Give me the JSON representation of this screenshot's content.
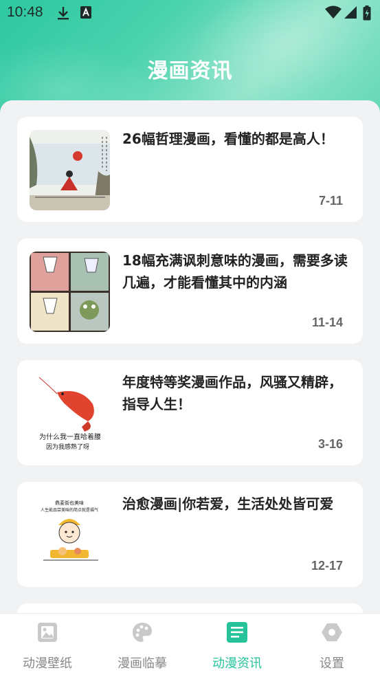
{
  "status_bar": {
    "time": "10:48"
  },
  "header": {
    "title": "漫画资讯"
  },
  "articles": [
    {
      "title": "26幅哲理漫画，看懂的都是高人！",
      "date": "7-11"
    },
    {
      "title": "18幅充满讽刺意味的漫画，需要多读几遍，才能看懂其中的内涵",
      "date": "11-14"
    },
    {
      "title": "年度特等奖漫画作品，风骚又精辟，指导人生！",
      "date": "3-16"
    },
    {
      "title": "治愈漫画|你若爱，生活处处皆可爱",
      "date": "12-17"
    }
  ],
  "thumbnail_text": {
    "shrimp_line1": "为什么我一直哈着腰",
    "shrimp_line2": "因为我感熟了呀",
    "food_line1": "鼎麦街也美味",
    "food_line2": "人生能品尝美味的简点就是福气"
  },
  "tabs": [
    {
      "label": "动漫壁纸",
      "icon": "wallpaper-icon",
      "active": false
    },
    {
      "label": "漫画临摹",
      "icon": "palette-icon",
      "active": false
    },
    {
      "label": "动漫资讯",
      "icon": "news-icon",
      "active": true
    },
    {
      "label": "设置",
      "icon": "settings-hexagon-icon",
      "active": false
    }
  ],
  "colors": {
    "accent": "#26c39a",
    "inactive": "#888888",
    "header_start": "#2ec8a0"
  }
}
